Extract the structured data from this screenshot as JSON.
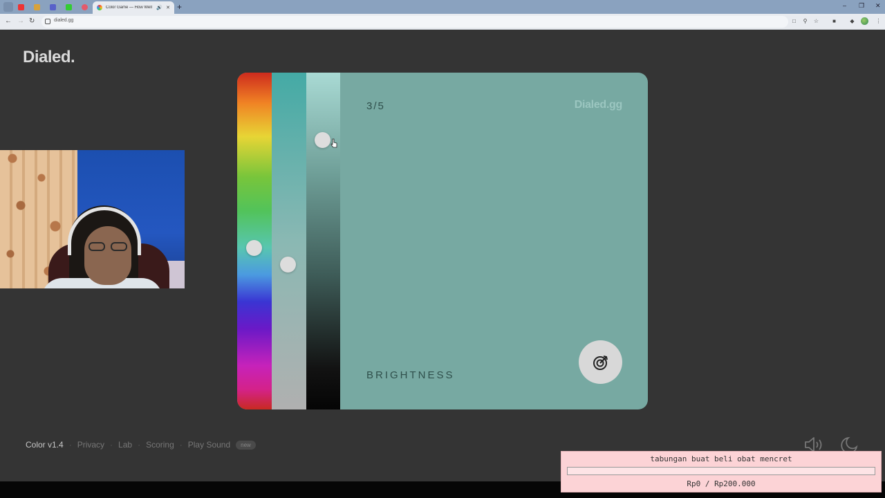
{
  "browser": {
    "active_tab_title": "Color Game — How Well Do You See Color?",
    "url": "dialed.gg",
    "tab_sound_icon": "speaker-icon",
    "new_tab_label": "+"
  },
  "page": {
    "logo": "Dialed.",
    "game": {
      "round": "3/5",
      "brand": "Dialed.gg",
      "mode": "BRIGHTNESS",
      "color": "#77a9a2",
      "sliders": {
        "hue": 0.52,
        "saturation": 0.57,
        "brightness": 0.2
      }
    },
    "footer": {
      "version": "Color v1.4",
      "sep": "·",
      "privacy": "Privacy",
      "lab": "Lab",
      "scoring": "Scoring",
      "play_sound": "Play Sound",
      "new_badge": "new"
    }
  },
  "overlay": {
    "title": "tabungan buat beli obat mencret",
    "progress": 0,
    "amount": "Rp0 / Rp200.000"
  }
}
